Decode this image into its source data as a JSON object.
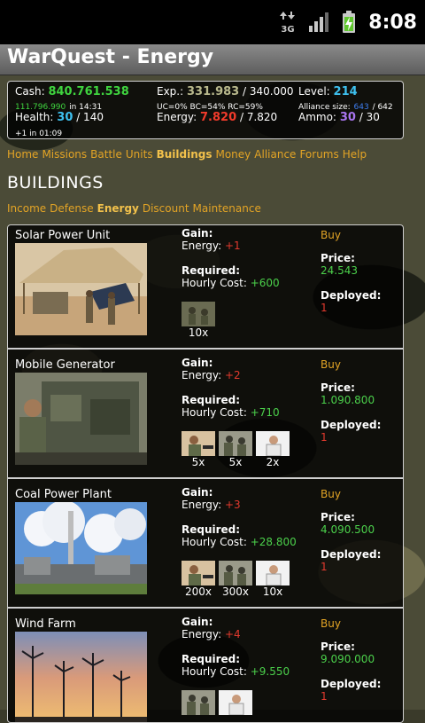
{
  "statusbar": {
    "time": "8:08",
    "network_label": "3G"
  },
  "app": {
    "title": "WarQuest - Energy"
  },
  "stats": {
    "cash_label": "Cash:",
    "cash_value": "840.761.538",
    "bank_value": "111.796.990",
    "bank_suffix": "in 14:31",
    "health_label": "Health:",
    "health_value": "30",
    "health_max": "/ 140",
    "health_regen": "+1 in 01:09",
    "exp_label": "Exp.:",
    "exp_value": "331.983",
    "exp_max": "/ 340.000",
    "exp_detail": "UC=0% BC=54% RC=59%",
    "energy_label": "Energy:",
    "energy_value": "7.820",
    "energy_max": "/ 7.820",
    "level_label": "Level:",
    "level_value": "214",
    "alliance_label": "Alliance size:",
    "alliance_value": "643",
    "alliance_max": "/ 642",
    "ammo_label": "Ammo:",
    "ammo_value": "30",
    "ammo_max": "/ 30",
    "colors": {
      "cash": "#3fd43f",
      "health": "#3ec1f0",
      "exp": "#b9b98d",
      "energy": "#f23b2b",
      "level": "#3ec1f0",
      "ammo": "#a975f0",
      "alliance": "#3e7ef0"
    }
  },
  "nav": {
    "home": "Home",
    "missions": "Missions",
    "battle": "Battle",
    "units": "Units",
    "buildings": "Buildings",
    "money": "Money",
    "alliance": "Alliance",
    "forums": "Forums",
    "help": "Help"
  },
  "page": {
    "heading": "BUILDINGS"
  },
  "subnav": {
    "income": "Income",
    "defense": "Defense",
    "energy": "Energy",
    "discount": "Discount",
    "maintenance": "Maintenance"
  },
  "labels": {
    "gain": "Gain:",
    "energy_prefix": "Energy: ",
    "required": "Required:",
    "hourly_prefix": "Hourly Cost: ",
    "buy": "Buy",
    "price": "Price:",
    "deployed": "Deployed:"
  },
  "buildings": [
    {
      "name": "Solar Power Unit",
      "gain": "+1",
      "hourly": "+600",
      "price": "24.543",
      "deployed": "1",
      "units": [
        "10x"
      ]
    },
    {
      "name": "Mobile Generator",
      "gain": "+2",
      "hourly": "+710",
      "price": "1.090.800",
      "deployed": "1",
      "units": [
        "5x",
        "5x",
        "2x"
      ]
    },
    {
      "name": "Coal Power Plant",
      "gain": "+3",
      "hourly": "+28.800",
      "price": "4.090.500",
      "deployed": "1",
      "units": [
        "200x",
        "300x",
        "10x"
      ]
    },
    {
      "name": "Wind Farm",
      "gain": "+4",
      "hourly": "+9.550",
      "price": "9.090.000",
      "deployed": "1",
      "units": []
    }
  ]
}
